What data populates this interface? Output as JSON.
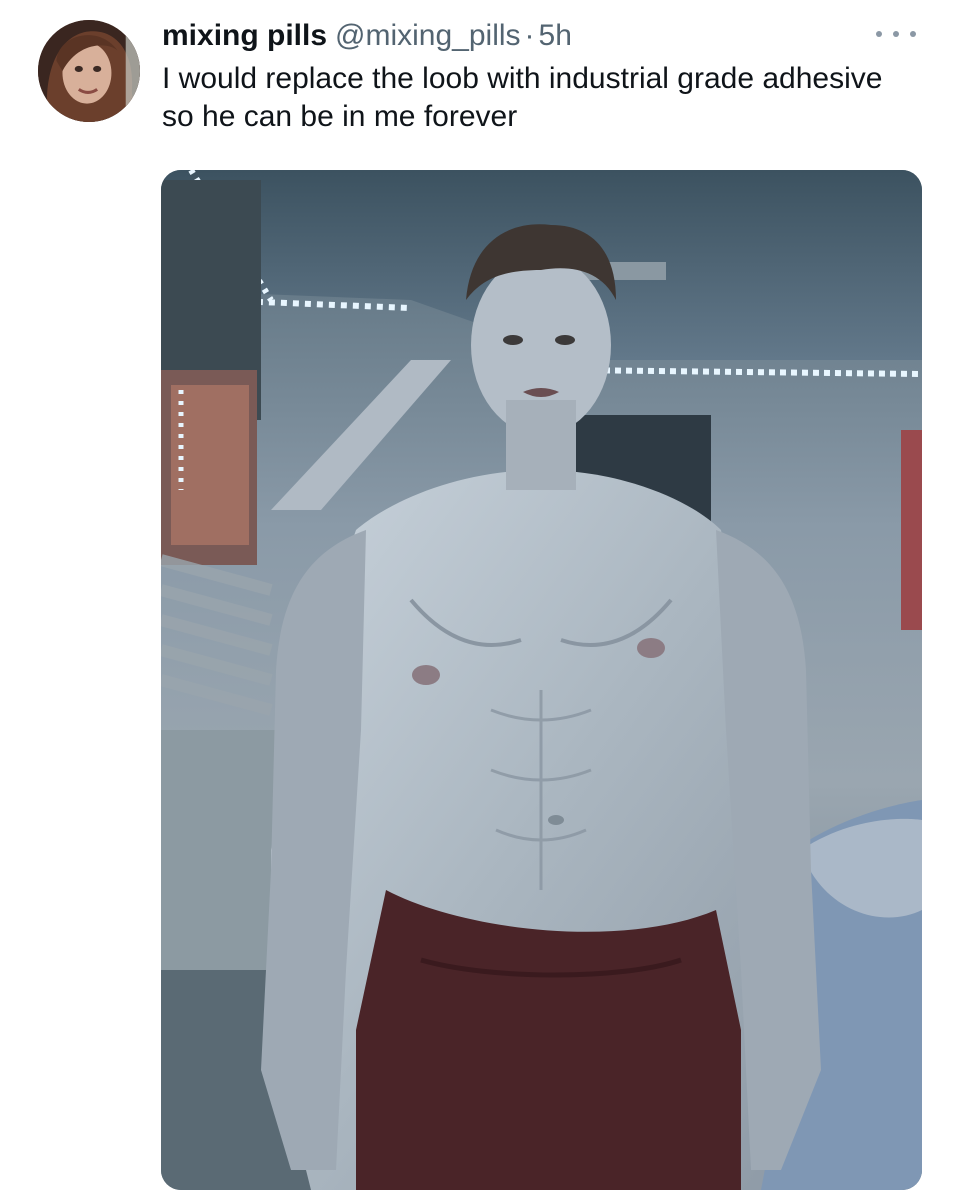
{
  "tweet": {
    "author_name": "mixing pills",
    "handle": "@mixing_pills",
    "separator": "·",
    "time": "5h",
    "text": "I would replace the loob with industrial grade adhesive so he can be in me forever"
  },
  "icons": {
    "more": "more-horizontal-icon"
  },
  "colors": {
    "text_primary": "#0f1419",
    "text_secondary": "#536471",
    "led_light": "#e8f6ff"
  }
}
